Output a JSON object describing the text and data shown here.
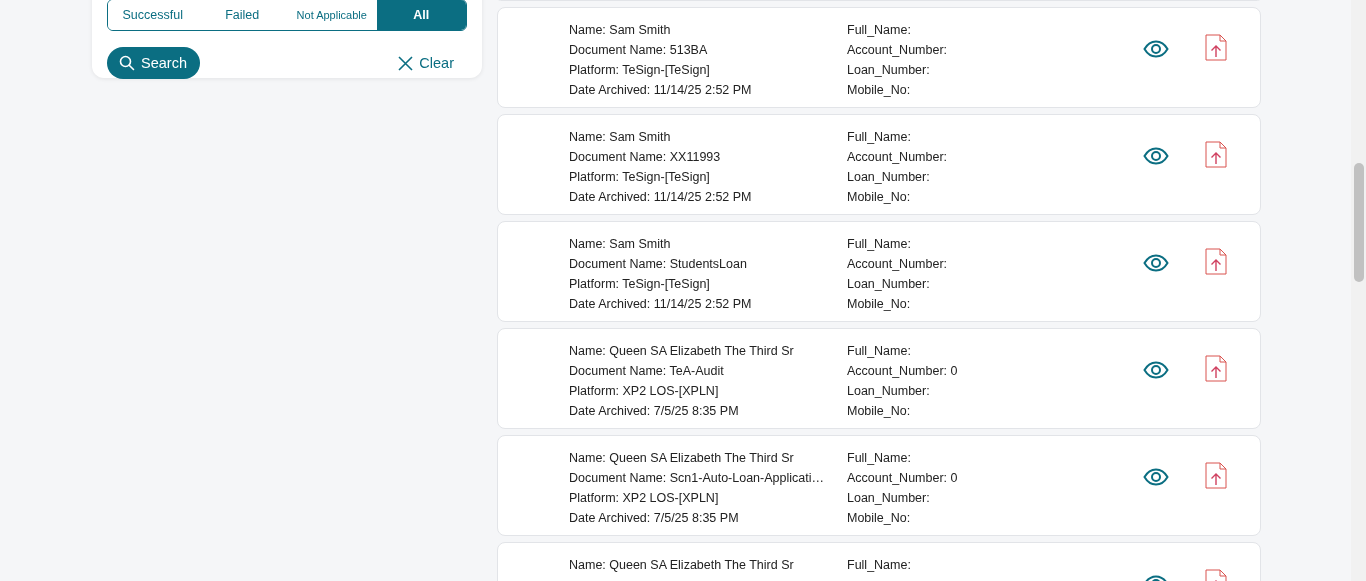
{
  "filter_panel": {
    "segments": [
      {
        "label": "Successful",
        "selected": false
      },
      {
        "label": "Failed",
        "selected": false
      },
      {
        "label": "Not Applicable",
        "selected": false
      },
      {
        "label": "All",
        "selected": true
      }
    ],
    "search_button": "Search",
    "clear_button": "Clear"
  },
  "records": [
    {
      "left": [
        "Name: Sam Smith",
        "Document Name: 513BA",
        "Platform: TeSign-[TeSign]",
        "Date Archived: 11/14/25 2:52 PM"
      ],
      "right": [
        "Full_Name:",
        "Account_Number:",
        "Loan_Number:",
        "Mobile_No:"
      ]
    },
    {
      "left": [
        "Name: Sam Smith",
        "Document Name: XX11993",
        "Platform: TeSign-[TeSign]",
        "Date Archived: 11/14/25 2:52 PM"
      ],
      "right": [
        "Full_Name:",
        "Account_Number:",
        "Loan_Number:",
        "Mobile_No:"
      ]
    },
    {
      "left": [
        "Name: Sam Smith",
        "Document Name: StudentsLoan",
        "Platform: TeSign-[TeSign]",
        "Date Archived: 11/14/25 2:52 PM"
      ],
      "right": [
        "Full_Name:",
        "Account_Number:",
        "Loan_Number:",
        "Mobile_No:"
      ]
    },
    {
      "left": [
        "Name: Queen SA Elizabeth The Third Sr",
        "Document Name: TeA-Audit",
        "Platform: XP2 LOS-[XPLN]",
        "Date Archived: 7/5/25 8:35 PM"
      ],
      "right": [
        "Full_Name:",
        "Account_Number: 0",
        "Loan_Number:",
        "Mobile_No:"
      ]
    },
    {
      "left": [
        "Name: Queen SA Elizabeth The Third Sr",
        "Document Name: Scn1-Auto-Loan-Applicati…",
        "Platform: XP2 LOS-[XPLN]",
        "Date Archived: 7/5/25 8:35 PM"
      ],
      "right": [
        "Full_Name:",
        "Account_Number: 0",
        "Loan_Number:",
        "Mobile_No:"
      ]
    },
    {
      "left": [
        "Name: Queen SA Elizabeth The Third Sr"
      ],
      "right": [
        "Full_Name:"
      ]
    }
  ]
}
